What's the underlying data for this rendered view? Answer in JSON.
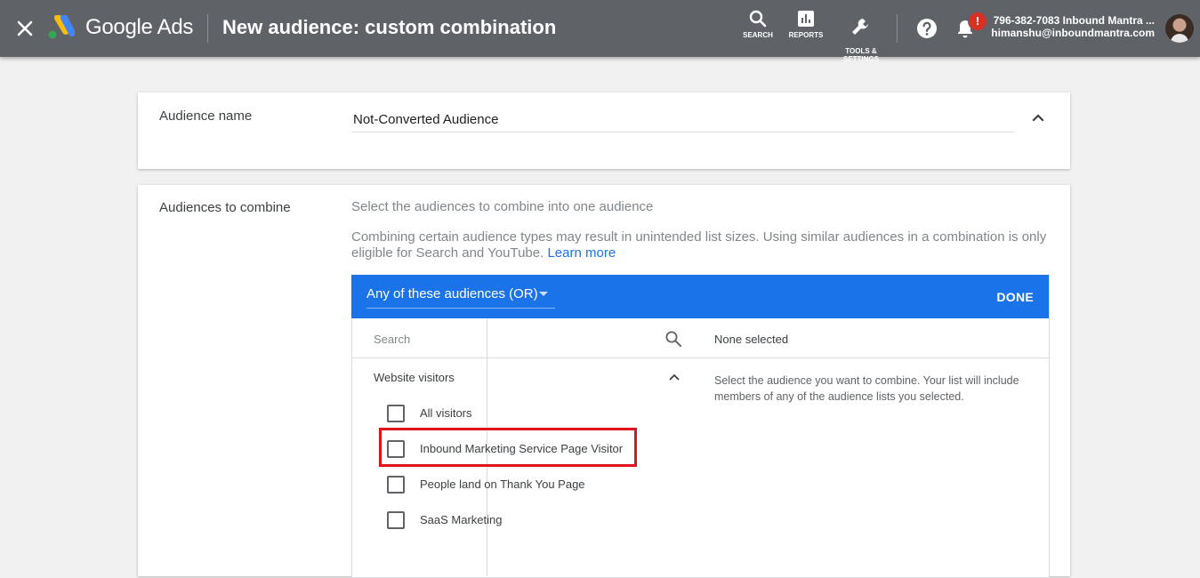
{
  "header": {
    "brand": "Google Ads",
    "title": "New audience: custom combination",
    "tools": [
      {
        "id": "search",
        "label": "SEARCH",
        "icon": "search-icon"
      },
      {
        "id": "reports",
        "label": "REPORTS",
        "icon": "bar-chart-icon"
      },
      {
        "id": "tools",
        "label": "TOOLS &\nSETTINGS",
        "icon": "wrench-icon"
      }
    ],
    "notification_badge": "!",
    "account_line1": "796-382-7083 Inbound Mantra ...",
    "account_line2": "himanshu@inboundmantra.com"
  },
  "audience_name": {
    "label": "Audience name",
    "value": "Not-Converted Audience"
  },
  "combine": {
    "label": "Audiences to combine",
    "hint1": "Select the audiences to combine into one audience",
    "hint2": "Combining certain audience types may result in unintended list sizes. Using similar audiences in a combination is only eligible for Search and YouTube.",
    "learn_more": "Learn more",
    "mode": "Any of these audiences (OR)",
    "done": "DONE",
    "search_placeholder": "Search",
    "none_selected": "None selected",
    "right_help": "Select the audience you want to combine. Your list will include members of any of the audience lists you selected.",
    "group": "Website visitors",
    "options": [
      "All visitors",
      "Inbound Marketing Service Page Visitor",
      "People land on Thank You Page",
      "SaaS Marketing"
    ]
  },
  "colors": {
    "topbar": "#5f6368",
    "accent": "#1a73e8",
    "highlight": "#e0121b",
    "badge": "#d93025"
  }
}
